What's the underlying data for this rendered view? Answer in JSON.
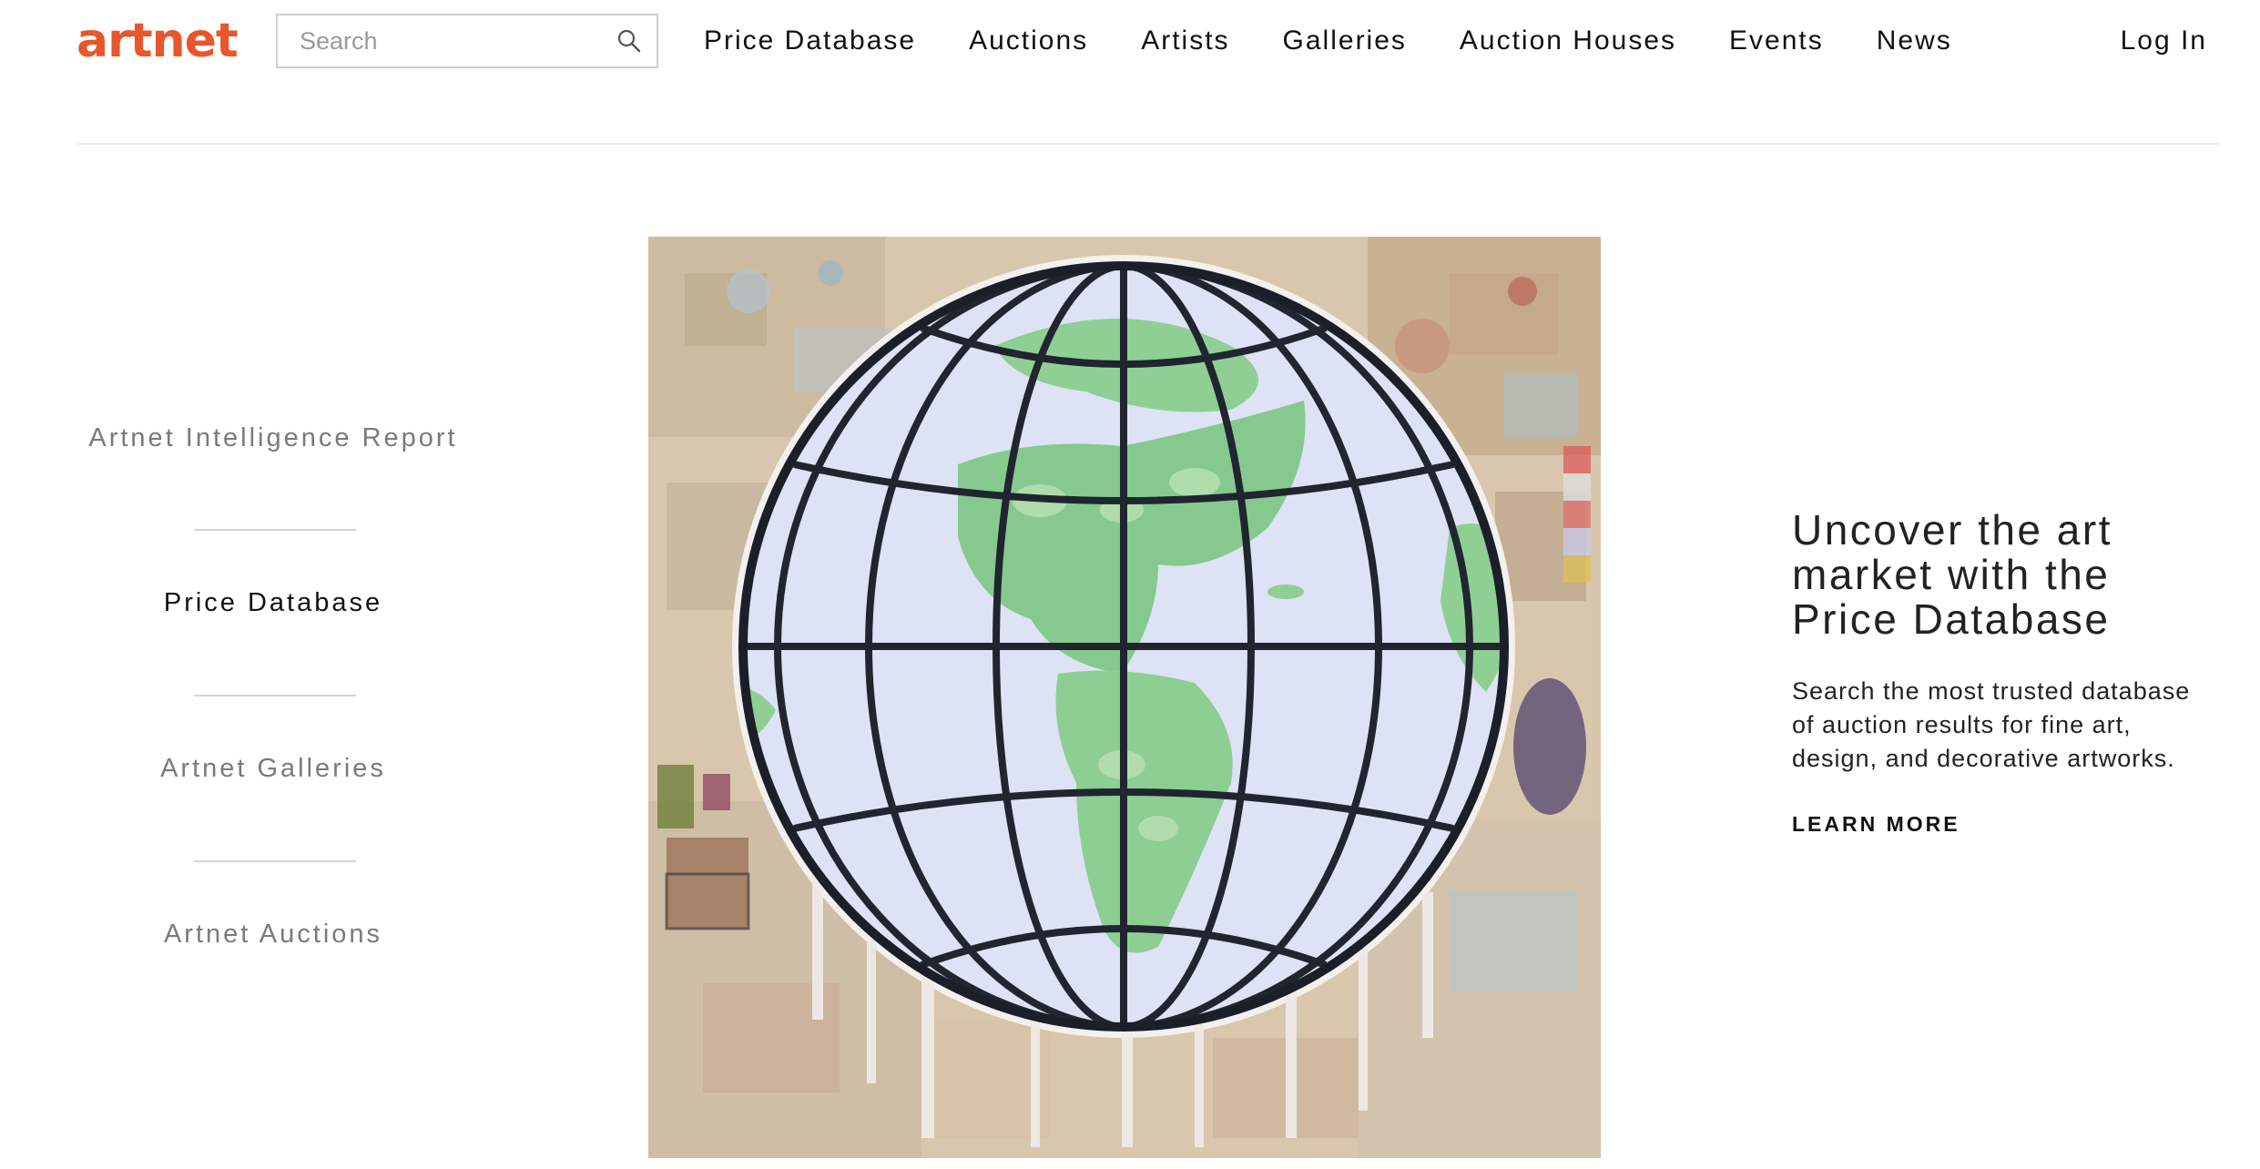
{
  "brand": {
    "logo_text": "artnet",
    "accent_color": "#e8562c"
  },
  "search": {
    "placeholder": "Search",
    "value": "",
    "icon": "search-icon"
  },
  "nav": {
    "items": [
      "Price Database",
      "Auctions",
      "Artists",
      "Galleries",
      "Auction Houses",
      "Events",
      "News"
    ],
    "login_label": "Log In"
  },
  "side_menu": {
    "items": [
      "Artnet Intelligence Report",
      "Price Database",
      "Artnet Galleries",
      "Artnet Auctions"
    ],
    "active_item": "Price Database"
  },
  "promo": {
    "heading": "Uncover the art market with the Price Database",
    "body": "Search the most trusted database of auction results for fine art, design, and decorative artworks.",
    "cta_label": "LEARN MORE"
  },
  "artwork": {
    "subject": "painted globe with grid lines over collage background"
  }
}
